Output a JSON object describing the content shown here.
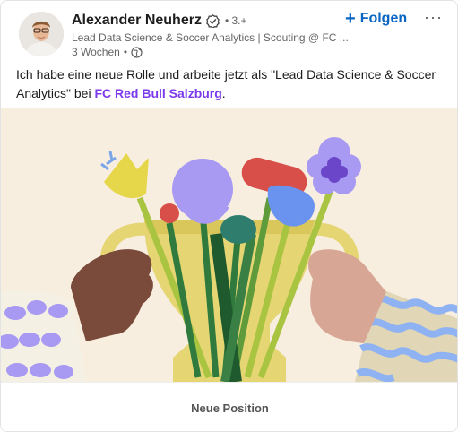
{
  "post": {
    "author_name": "Alexander Neuherz",
    "degree": "• 3.+",
    "headline": "Lead Data Science & Soccer Analytics | Scouting @ FC ...",
    "time": "3 Wochen",
    "time_sep": "•",
    "follow_label": "Folgen",
    "more_label": "···",
    "text_before": "Ich habe eine neue Rolle und arbeite jetzt als \"Lead Data Science & Soccer Analytics\" bei ",
    "mention": "FC Red Bull Salzburg",
    "text_after": ".",
    "caption": "Neue Position"
  },
  "icons": {
    "verified": "verified-badge-icon",
    "globe": "globe-icon",
    "plus": "plus-icon",
    "more": "more-options-icon"
  },
  "colors": {
    "accent": "#0a66c2",
    "mention": "#7c3aed",
    "illustration_bg": "#f8eee0"
  }
}
